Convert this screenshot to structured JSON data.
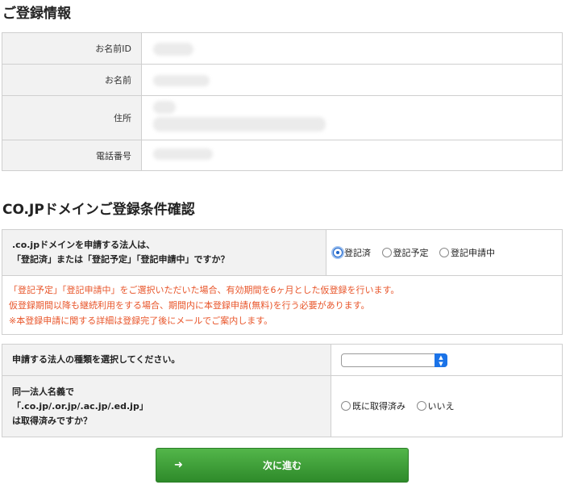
{
  "registration_section": {
    "title": "ご登録情報",
    "rows": [
      {
        "label": "お名前ID"
      },
      {
        "label": "お名前"
      },
      {
        "label": "住所"
      },
      {
        "label": "電話番号"
      }
    ]
  },
  "conditions_section": {
    "title": "CO.JPドメインご登録条件確認",
    "question_line1": ".co.jpドメインを申請する法人は、",
    "question_line2": "「登記済」または「登記予定」「登記申請中」ですか？",
    "options": [
      {
        "label": "登記済",
        "selected": true
      },
      {
        "label": "登記予定",
        "selected": false
      },
      {
        "label": "登記申請中",
        "selected": false
      }
    ],
    "notice": [
      "「登記予定」「登記申請中」をご選択いただいた場合、有効期間を6ヶ月とした仮登録を行います。",
      "仮登録期間以降も継続利用をする場合、期間内に本登録申請(無料)を行う必要があります。",
      "※本登録申請に関する詳細は登録完了後にメールでご案内します。"
    ],
    "notice_color": "#e8552a"
  },
  "corporation_section": {
    "type_question": "申請する法人の種類を選択してください。",
    "type_select_value": "",
    "same_name_line1": "同一法人名義で",
    "same_name_line2": "「.co.jp/.or.jp/.ac.jp/.ed.jp」",
    "same_name_line3": "は取得済みですか？",
    "options": [
      {
        "label": "既に取得済み",
        "selected": false
      },
      {
        "label": "いいえ",
        "selected": false
      }
    ]
  },
  "next_button": {
    "label": "次に進む",
    "icon": "arrow-right-icon",
    "color": "#3a9d35"
  }
}
